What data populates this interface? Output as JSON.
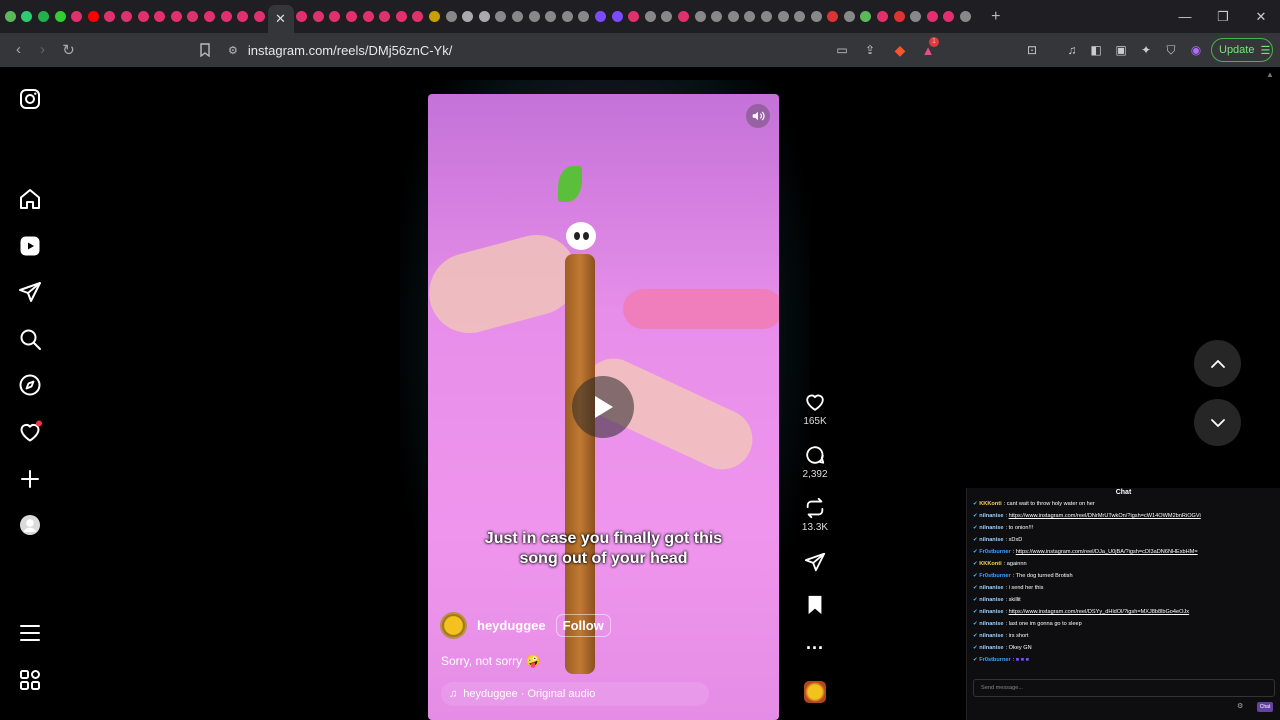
{
  "browser": {
    "tab_favicon_colors": [
      "#5cb85c",
      "#2ecc71",
      "#22b14c",
      "#33cc33",
      "#e1306c",
      "#ff0000",
      "#e1306c",
      "#e1306c",
      "#e1306c",
      "#e1306c",
      "#e1306c",
      "#e1306c",
      "#e1306c",
      "#e1306c",
      "#e1306c",
      "#e1306c"
    ],
    "tab_favicon_colors_right": [
      "#e1306c",
      "#e1306c",
      "#e1306c",
      "#e1306c",
      "#e1306c",
      "#e1306c",
      "#e1306c",
      "#e1306c",
      "#c8a000",
      "#888",
      "#aaa",
      "#aaa",
      "#888",
      "#888",
      "#888",
      "#888",
      "#888",
      "#888",
      "#7b4cff",
      "#7b4cff",
      "#e1306c",
      "#888",
      "#888",
      "#e1306c",
      "#888",
      "#888",
      "#888",
      "#888",
      "#888",
      "#888",
      "#888",
      "#888",
      "#d33",
      "#888",
      "#5cb85c",
      "#e1306c",
      "#d33",
      "#888",
      "#e1306c",
      "#e1306c",
      "#888"
    ],
    "active_tab_close": "✕",
    "new_tab": "+",
    "url": "instagram.com/reels/DMj56znC-Yk/",
    "update_label": "Update",
    "notification_badge": "1"
  },
  "sidebar": {
    "items": [
      "instagram-logo",
      "home",
      "reels",
      "direct",
      "search",
      "explore",
      "notifications",
      "create",
      "profile",
      "more",
      "also-from-meta"
    ]
  },
  "reel": {
    "subtitle_line1": "Just in case you finally got this",
    "subtitle_line2": "song out of your head",
    "author": "heyduggee",
    "follow_label": "Follow",
    "caption": "Sorry, not sorry 🤪",
    "audio": "heyduggee · Original audio"
  },
  "actions": {
    "likes": "165K",
    "comments": "2,392",
    "reposts": "13.3K",
    "more": "..."
  },
  "chat": {
    "title": "Chat",
    "input_placeholder": "Send message...",
    "send_label": "Chat",
    "messages": [
      {
        "user": "KKKonti",
        "user_color": "#ffd34e",
        "text": "cant wait to throw holy water on her",
        "link": false
      },
      {
        "user": "nilnanise",
        "user_color": "#9ad1ff",
        "text": "https://www.instagram.com/reel/DNrMrUTwkOn/?igsh=cW14OWM2bnRiOGVi",
        "link": true
      },
      {
        "user": "nilnanise",
        "user_color": "#9ad1ff",
        "text": "to onion!!!",
        "link": false
      },
      {
        "user": "nilnanise",
        "user_color": "#9ad1ff",
        "text": "xDxD",
        "link": false
      },
      {
        "user": "Fr0stburner",
        "user_color": "#3fa3ff",
        "text": "https://www.instagram.com/reel/DJa_U0jBA/?igsh=cDI3aDN6NHExbHM=",
        "link": true
      },
      {
        "user": "KKKonti",
        "user_color": "#ffd34e",
        "text": "againnn",
        "link": false
      },
      {
        "user": "Fr0stburner",
        "user_color": "#3fa3ff",
        "text": "The dog turned Brotish",
        "link": false
      },
      {
        "user": "nilnanise",
        "user_color": "#9ad1ff",
        "text": "i send her this",
        "link": false
      },
      {
        "user": "nilnanise",
        "user_color": "#9ad1ff",
        "text": "skillit",
        "link": false
      },
      {
        "user": "nilnanise",
        "user_color": "#9ad1ff",
        "text": "https://www.instagram.com/reel/DSYy_dHldOl/?igsh=MXJ8b8lbGo4eOJx",
        "link": true
      },
      {
        "user": "nilnanise",
        "user_color": "#9ad1ff",
        "text": "last one im gonna go to sleep",
        "link": false
      },
      {
        "user": "nilnanise",
        "user_color": "#9ad1ff",
        "text": "irs short",
        "link": false
      },
      {
        "user": "nilnanise",
        "user_color": "#9ad1ff",
        "text": "Okey GN",
        "link": false
      },
      {
        "user": "Fr0stburner",
        "user_color": "#3fa3ff",
        "text": "",
        "link": false
      }
    ]
  }
}
